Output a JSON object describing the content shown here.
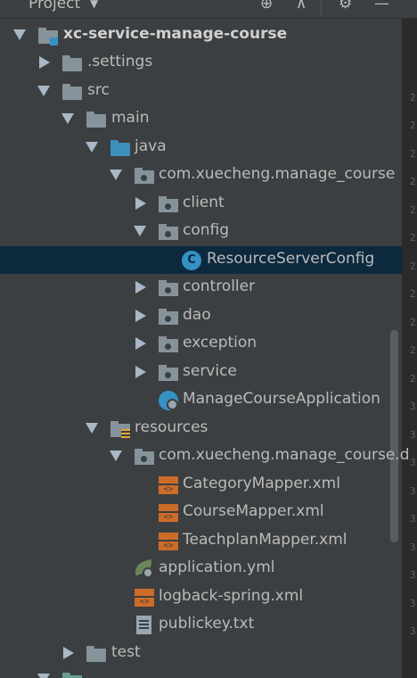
{
  "header": {
    "title": "Project"
  },
  "tree": {
    "root": "xc-service-manage-course",
    "settings": ".settings",
    "src": "src",
    "main": "main",
    "java": "java",
    "pkg_main": "com.xuecheng.manage_course",
    "client": "client",
    "config": "config",
    "resource_server_config": "ResourceServerConfig",
    "controller": "controller",
    "dao": "dao",
    "exception": "exception",
    "service": "service",
    "app_class": "ManageCourseApplication",
    "resources": "resources",
    "pkg_res": "com.xuecheng.manage_course.d",
    "category_mapper": "CategoryMapper.xml",
    "course_mapper": "CourseMapper.xml",
    "teachplan_mapper": "TeachplanMapper.xml",
    "application_yml": "application.yml",
    "logback": "logback-spring.xml",
    "publickey": "publickey.txt",
    "test": "test"
  },
  "gutter_line_numbers": [
    "2",
    "2",
    "2",
    "2",
    "2",
    "2",
    "2",
    "2",
    "2",
    "2",
    "2",
    "3",
    "3",
    "3",
    "3",
    "3",
    "3",
    "3",
    "3",
    "3",
    "3",
    "4",
    "4",
    "4"
  ],
  "icons": {
    "class": "C",
    "xml": "<>",
    "header_tools": [
      "⊕",
      "⊼",
      "⚙",
      "—"
    ]
  }
}
